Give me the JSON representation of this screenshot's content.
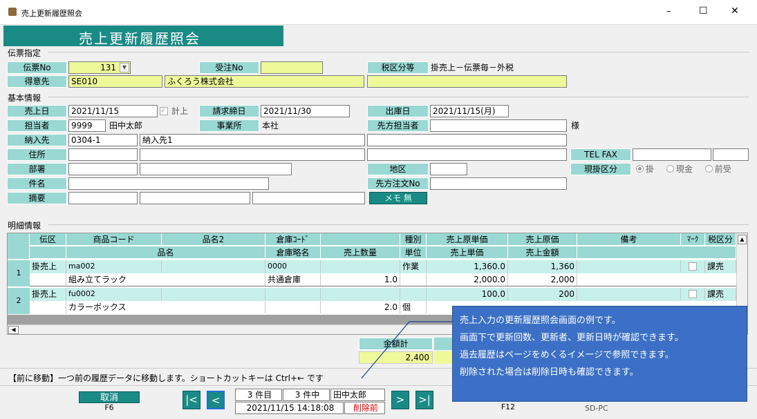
{
  "window": {
    "title": "売上更新履歴照会",
    "minimize": "–",
    "maximize": "☐",
    "close": "✕"
  },
  "banner": {
    "title": "売上更新履歴照会"
  },
  "sections": {
    "denpyo": "伝票指定",
    "kihon": "基本情報",
    "meisai": "明細情報"
  },
  "denpyo": {
    "no_label": "伝票No",
    "no_value": "131",
    "juchu_label": "受注No",
    "juchu_value": "",
    "zeiku_label": "税区分等",
    "zeiku_value": "掛売上－伝票毎－外税",
    "tokui_label": "得意先",
    "tokui_code": "SE010",
    "tokui_name": "ふくろう株式会社",
    "tokui_extra": ""
  },
  "kihon": {
    "uriagebi_label": "売上日",
    "uriagebi": "2021/11/15",
    "keijo": "計上",
    "seikyu_label": "請求締日",
    "seikyu": "2021/11/30",
    "shukko_label": "出庫日",
    "shukko": "2021/11/15(月)",
    "tanto_label": "担当者",
    "tanto_code": "9999",
    "tanto_name": "田中太郎",
    "jigyo_label": "事業所",
    "jigyo": "本社",
    "saki_tanto_label": "先方担当者",
    "saki_tanto": "",
    "sama": "様",
    "nonyu_label": "納入先",
    "nonyu_code": "0304-1",
    "nonyu_name": "納入先1",
    "jusho_label": "住所",
    "telfax_label": "TEL FAX",
    "busho_label": "部署",
    "chiku_label": "地区",
    "genkake_label": "現掛区分",
    "radio_kake": "掛",
    "radio_genkin": "現金",
    "radio_maeuke": "前受",
    "kenmei_label": "件名",
    "saki_chumon_label": "先方注文No",
    "tekiyo_label": "摘要",
    "memo_button": "メモ 無"
  },
  "grid": {
    "h1": [
      "伝区",
      "商品コード",
      "品名2",
      "倉庫ｺｰﾄﾞ",
      "",
      "種別",
      "売上原単価",
      "売上原価",
      "備考",
      "ﾏｰｸ",
      "税区分"
    ],
    "h2": [
      "品名",
      "倉庫略名",
      "売上数量",
      "単位",
      "売上単価",
      "売上金額"
    ],
    "rows": [
      {
        "num": "1",
        "denku": "掛売上",
        "code": "ma002",
        "hinmei2": "",
        "soko_code": "0000",
        "shubetsu": "作業",
        "gentanka": "1,360.0",
        "genka": "1,360",
        "zeiku": "課売",
        "hinmei": "組み立てラック",
        "soko_name": "共通倉庫",
        "suryo": "1.0",
        "tani": "",
        "tanka": "2,000.0",
        "kingaku": "2,000"
      },
      {
        "num": "2",
        "denku": "掛売上",
        "code": "fu0002",
        "hinmei2": "",
        "soko_code": "",
        "shubetsu": "",
        "gentanka": "100.0",
        "genka": "200",
        "zeiku": "課売",
        "hinmei": "カラーボックス",
        "soko_name": "",
        "suryo": "2.0",
        "tani": "個",
        "tanka": "",
        "kingaku": ""
      }
    ]
  },
  "total": {
    "label": "金額計",
    "value": "2,400"
  },
  "tooltip": [
    "売上入力の更新履歴照会画面の例です。",
    "画面下で更新回数、更新者、更新日時が確認できます。",
    "過去履歴はページをめくるイメージで参照できます。",
    "削除された場合は削除日時も確認できます。"
  ],
  "status": {
    "message": "【前に移動】一つ前の履歴データに移動します。ショートカットキーは Ctrl+← です"
  },
  "footer": {
    "cancel_label": "取消",
    "cancel_key": "F6",
    "nav_first": "|<",
    "nav_prev": "<",
    "nav_next": ">",
    "nav_last": ">|",
    "kenme": "3 件目",
    "kenchu": "3 件中",
    "user": "田中太郎",
    "datetime": "2021/11/15 14:18:08",
    "deleted": "削除前",
    "f12_key": "F12",
    "pc": "SD-PC"
  }
}
